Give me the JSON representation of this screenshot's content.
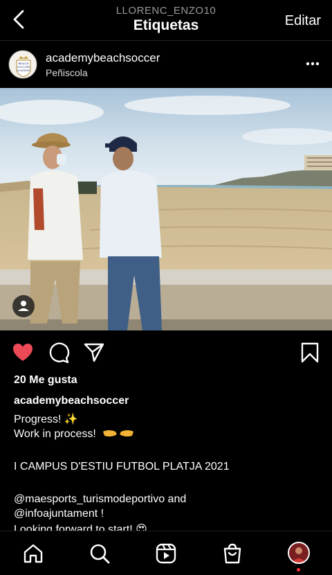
{
  "header": {
    "subtitle": "LLORENC_ENZO10",
    "title": "Etiquetas",
    "edit_label": "Editar"
  },
  "post": {
    "username": "academybeachsoccer",
    "location": "Peñiscola",
    "avatar_text": "BEACH SOCCER ACADEMY",
    "likes": "20 Me gusta",
    "caption_user": "academybeachsoccer",
    "caption_lines": [
      "Progress! ✨",
      "Work in process!",
      "I CAMPUS D'ESTIU FUTBOL PLATJA 2021",
      "@maesports_turismodeportivo and",
      "@infoajuntament !",
      "Looking forward to start! 😍"
    ],
    "liked": true
  },
  "icons": {
    "back": "chevron-left-icon",
    "more": "more-horizontal-icon",
    "like": "heart-icon",
    "comment": "comment-icon",
    "share": "send-icon",
    "save": "bookmark-icon",
    "tag": "person-tag-icon",
    "home": "home-icon",
    "search": "search-icon",
    "reels": "reels-icon",
    "shop": "shopping-bag-icon"
  },
  "colors": {
    "background": "#000000",
    "like_red": "#ed4956",
    "notification_dot": "#ff3040"
  }
}
